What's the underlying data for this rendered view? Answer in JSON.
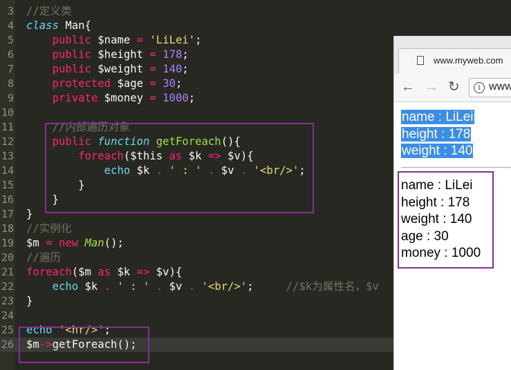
{
  "editor": {
    "lines": [
      {
        "num": "3",
        "segs": [
          [
            "cmt",
            "//定义类"
          ]
        ]
      },
      {
        "num": "4",
        "segs": [
          [
            "class",
            "class"
          ],
          [
            "text",
            " Man{"
          ]
        ]
      },
      {
        "num": "5",
        "segs": [
          [
            "text",
            "    "
          ],
          [
            "kw",
            "public"
          ],
          [
            "text",
            " $name "
          ],
          [
            "kw",
            "="
          ],
          [
            "text",
            " "
          ],
          [
            "str",
            "'LiLei'"
          ],
          [
            "text",
            ";"
          ]
        ]
      },
      {
        "num": "6",
        "segs": [
          [
            "text",
            "    "
          ],
          [
            "kw",
            "public"
          ],
          [
            "text",
            " $height "
          ],
          [
            "kw",
            "="
          ],
          [
            "text",
            " "
          ],
          [
            "num",
            "178"
          ],
          [
            "text",
            ";"
          ]
        ]
      },
      {
        "num": "7",
        "segs": [
          [
            "text",
            "    "
          ],
          [
            "kw",
            "public"
          ],
          [
            "text",
            " $weight "
          ],
          [
            "kw",
            "="
          ],
          [
            "text",
            " "
          ],
          [
            "num",
            "140"
          ],
          [
            "text",
            ";"
          ]
        ]
      },
      {
        "num": "8",
        "segs": [
          [
            "text",
            "    "
          ],
          [
            "kw",
            "protected"
          ],
          [
            "text",
            " $age "
          ],
          [
            "kw",
            "="
          ],
          [
            "text",
            " "
          ],
          [
            "num",
            "30"
          ],
          [
            "text",
            ";"
          ]
        ]
      },
      {
        "num": "9",
        "segs": [
          [
            "text",
            "    "
          ],
          [
            "kw",
            "private"
          ],
          [
            "text",
            " $money "
          ],
          [
            "kw",
            "="
          ],
          [
            "text",
            " "
          ],
          [
            "num",
            "1000"
          ],
          [
            "text",
            ";"
          ]
        ]
      },
      {
        "num": "10",
        "segs": []
      },
      {
        "num": "11",
        "segs": [
          [
            "text",
            "    "
          ],
          [
            "cmt",
            "//内部遍历对象"
          ]
        ]
      },
      {
        "num": "12",
        "segs": [
          [
            "text",
            "    "
          ],
          [
            "kw",
            "public"
          ],
          [
            "text",
            " "
          ],
          [
            "class",
            "function"
          ],
          [
            "text",
            " "
          ],
          [
            "name",
            "getForeach"
          ],
          [
            "text",
            "(){"
          ]
        ]
      },
      {
        "num": "13",
        "segs": [
          [
            "text",
            "        "
          ],
          [
            "kw",
            "foreach"
          ],
          [
            "text",
            "($this "
          ],
          [
            "kw",
            "as"
          ],
          [
            "text",
            " $k "
          ],
          [
            "kw",
            "=>"
          ],
          [
            "text",
            " $v){"
          ]
        ]
      },
      {
        "num": "14",
        "segs": [
          [
            "text",
            "            "
          ],
          [
            "echo",
            "echo"
          ],
          [
            "text",
            " $k "
          ],
          [
            "kw",
            "."
          ],
          [
            "text",
            " "
          ],
          [
            "str",
            "' : '"
          ],
          [
            "text",
            " "
          ],
          [
            "kw",
            "."
          ],
          [
            "text",
            " $v "
          ],
          [
            "kw",
            "."
          ],
          [
            "text",
            " "
          ],
          [
            "str",
            "'<br/>'"
          ],
          [
            "text",
            ";"
          ]
        ]
      },
      {
        "num": "15",
        "segs": [
          [
            "text",
            "        }"
          ]
        ]
      },
      {
        "num": "16",
        "segs": [
          [
            "text",
            "    }"
          ]
        ]
      },
      {
        "num": "17",
        "segs": [
          [
            "text",
            "}"
          ]
        ]
      },
      {
        "num": "18",
        "segs": [
          [
            "cmt",
            "//实例化"
          ]
        ]
      },
      {
        "num": "19",
        "segs": [
          [
            "text",
            "$m "
          ],
          [
            "kw",
            "="
          ],
          [
            "text",
            " "
          ],
          [
            "kw",
            "new"
          ],
          [
            "text",
            " "
          ],
          [
            "type",
            "Man"
          ],
          [
            "text",
            "();"
          ]
        ]
      },
      {
        "num": "20",
        "segs": [
          [
            "cmt",
            "//遍历"
          ]
        ]
      },
      {
        "num": "21",
        "segs": [
          [
            "kw",
            "foreach"
          ],
          [
            "text",
            "($m "
          ],
          [
            "kw",
            "as"
          ],
          [
            "text",
            " $k "
          ],
          [
            "kw",
            "=>"
          ],
          [
            "text",
            " $v){"
          ]
        ]
      },
      {
        "num": "22",
        "segs": [
          [
            "text",
            "    "
          ],
          [
            "echo",
            "echo"
          ],
          [
            "text",
            " $k "
          ],
          [
            "kw",
            "."
          ],
          [
            "text",
            " "
          ],
          [
            "str",
            "' : '"
          ],
          [
            "text",
            " "
          ],
          [
            "kw",
            "."
          ],
          [
            "text",
            " $v "
          ],
          [
            "kw",
            "."
          ],
          [
            "text",
            " "
          ],
          [
            "str",
            "'<br/>'"
          ],
          [
            "text",
            ";     "
          ],
          [
            "cmt",
            "//$k为属性名，$v"
          ]
        ]
      },
      {
        "num": "23",
        "segs": [
          [
            "text",
            "}"
          ]
        ]
      },
      {
        "num": "24",
        "segs": []
      },
      {
        "num": "25",
        "segs": [
          [
            "echo",
            "echo"
          ],
          [
            "text",
            " "
          ],
          [
            "str",
            "'<hr/>'"
          ],
          [
            "text",
            ";"
          ]
        ]
      },
      {
        "num": "26",
        "segs": [
          [
            "text",
            "$m"
          ],
          [
            "kw",
            "->"
          ],
          [
            "text",
            "getForeach();"
          ]
        ]
      }
    ],
    "active_line": "26",
    "highlight_color": "#8a2c97"
  },
  "browser": {
    "tab_title": "www.myweb.com",
    "url_text": "www",
    "back_icon": "back-arrow-icon",
    "forward_icon": "forward-arrow-icon",
    "reload_icon": "reload-icon",
    "info_icon": "info-icon",
    "selected_output": [
      "name : LiLei",
      "height : 178",
      "weight : 140"
    ],
    "boxed_output": [
      "name : LiLei",
      "height : 178",
      "weight : 140",
      "age : 30",
      "money : 1000"
    ]
  },
  "colors": {
    "editor_bg": "#272822",
    "selection": "#3a8ee6",
    "box_border": "#8a2c97"
  }
}
